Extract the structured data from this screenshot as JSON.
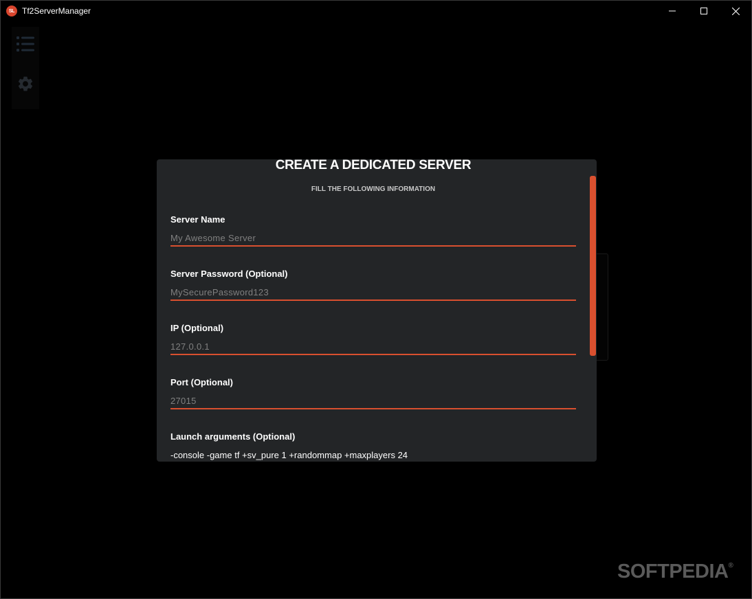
{
  "window": {
    "title": "Tf2ServerManager",
    "logo_text": "SL",
    "controls": [
      "minimize-icon",
      "maximize-icon",
      "close-icon"
    ]
  },
  "sidebar": {
    "items": [
      {
        "name": "list-icon"
      },
      {
        "name": "gear-icon"
      }
    ]
  },
  "dialog": {
    "title": "CREATE A DEDICATED SERVER",
    "subtitle": "FILL THE FOLLOWING INFORMATION",
    "fields": [
      {
        "label": "Server Name",
        "placeholder": "My Awesome Server",
        "value": ""
      },
      {
        "label": "Server Password (Optional)",
        "placeholder": "MySecurePassword123",
        "value": ""
      },
      {
        "label": "IP (Optional)",
        "placeholder": "127.0.0.1",
        "value": ""
      },
      {
        "label": "Port (Optional)",
        "placeholder": "27015",
        "value": ""
      }
    ],
    "launch_args": {
      "label": "Launch arguments (Optional)",
      "value": "-console -game tf +sv_pure 1 +randommap +maxplayers 24"
    }
  },
  "watermark": {
    "text": "SOFTPEDIA",
    "mark": "®"
  },
  "colors": {
    "accent": "#d9502f",
    "dialog_bg": "#232527",
    "window_bg": "#000000"
  }
}
